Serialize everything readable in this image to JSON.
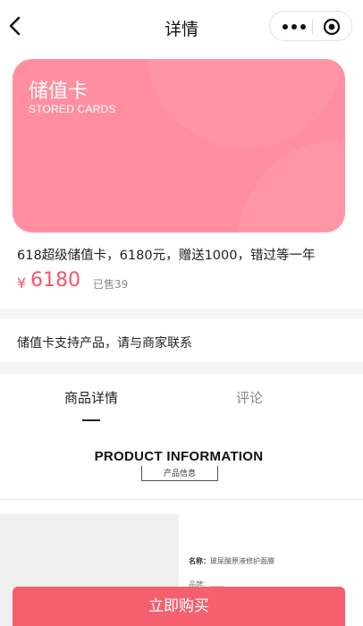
{
  "nav": {
    "title": "详情",
    "icons": [
      "back-chevron-icon",
      "more-dots-icon",
      "target-close-icon"
    ]
  },
  "card": {
    "title": "储值卡",
    "subtitle": "STORED CARDS",
    "color": "#ff8fa0"
  },
  "product": {
    "name": "618超级储值卡，6180元，赠送1000，错过等一年",
    "currency": "¥",
    "price": "6180",
    "sold": "已售39"
  },
  "notice": {
    "text": "储值卡支持产品，请与商家联系"
  },
  "tabs": [
    {
      "label": "商品详情",
      "active": true
    },
    {
      "label": "评论",
      "active": false
    }
  ],
  "detail": {
    "heading": "PRODUCT INFORMATION",
    "subheading": "产品信息",
    "spec_label": "名称：",
    "spec_value": "玻尿酸原液修护面膜",
    "spec_line2": "品牌：……"
  },
  "buy": {
    "label": "立即购买",
    "color": "#f4606e"
  }
}
